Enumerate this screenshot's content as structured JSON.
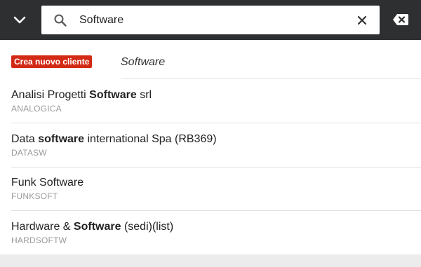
{
  "search": {
    "value": "Software",
    "placeholder": ""
  },
  "icons": {
    "back": "chevron-down-icon",
    "search": "search-icon",
    "clear": "close-icon",
    "backspace": "backspace-icon"
  },
  "colors": {
    "topbar": "#2d2f31",
    "create_button": "#d32a16",
    "code_text": "#9a9a9a"
  },
  "create": {
    "label": "Crea nuovo cliente",
    "query": "Software"
  },
  "results": [
    {
      "pre": "Analisi Progetti ",
      "match": "Software",
      "post": " srl",
      "code": "ANALOGICA"
    },
    {
      "pre": "Data ",
      "match": "software",
      "post": " international Spa (RB369)",
      "code": "DATASW"
    },
    {
      "pre": "Funk Software",
      "match": "",
      "post": "",
      "code": "FUNKSOFT"
    },
    {
      "pre": "Hardware & ",
      "match": "Software",
      "post": " (sedi)(list)",
      "code": "HARDSOFTW"
    }
  ]
}
